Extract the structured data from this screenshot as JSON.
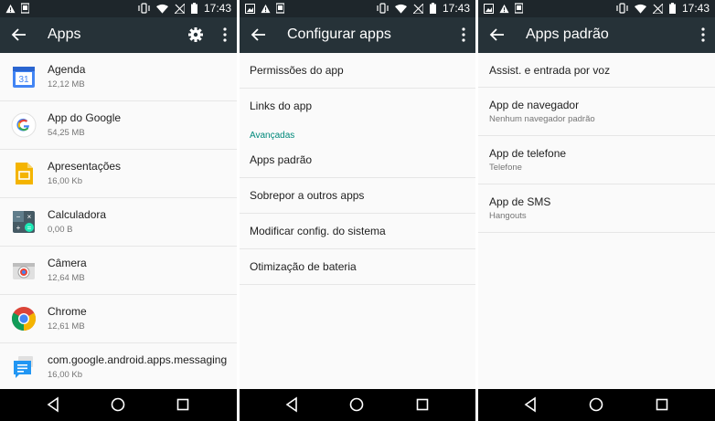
{
  "statusbar": {
    "time": "17:43"
  },
  "colors": {
    "appbar": "#263238",
    "statusbar": "#1e262b",
    "accent": "#00897b"
  },
  "screen1": {
    "title": "Apps",
    "apps": [
      {
        "name": "Agenda",
        "size": "12,12 MB",
        "icon": "calendar-icon"
      },
      {
        "name": "App do Google",
        "size": "54,25 MB",
        "icon": "google-icon"
      },
      {
        "name": "Apresentações",
        "size": "16,00 Kb",
        "icon": "slides-icon"
      },
      {
        "name": "Calculadora",
        "size": "0,00 B",
        "icon": "calculator-icon"
      },
      {
        "name": "Câmera",
        "size": "12,64 MB",
        "icon": "camera-icon"
      },
      {
        "name": "Chrome",
        "size": "12,61 MB",
        "icon": "chrome-icon"
      },
      {
        "name": "com.google.android.apps.messaging",
        "size": "16,00 Kb",
        "icon": "messaging-icon"
      }
    ]
  },
  "screen2": {
    "title": "Configurar apps",
    "items_top": [
      "Permissões do app",
      "Links do app"
    ],
    "section": "Avançadas",
    "items_adv": [
      "Apps padrão",
      "Sobrepor a outros apps",
      "Modificar config. do sistema",
      "Otimização de bateria"
    ]
  },
  "screen3": {
    "title": "Apps padrão",
    "assist": "Assist. e entrada por voz",
    "items": [
      {
        "label": "App de navegador",
        "sub": "Nenhum navegador padrão"
      },
      {
        "label": "App de telefone",
        "sub": "Telefone"
      },
      {
        "label": "App de SMS",
        "sub": "Hangouts"
      }
    ]
  }
}
